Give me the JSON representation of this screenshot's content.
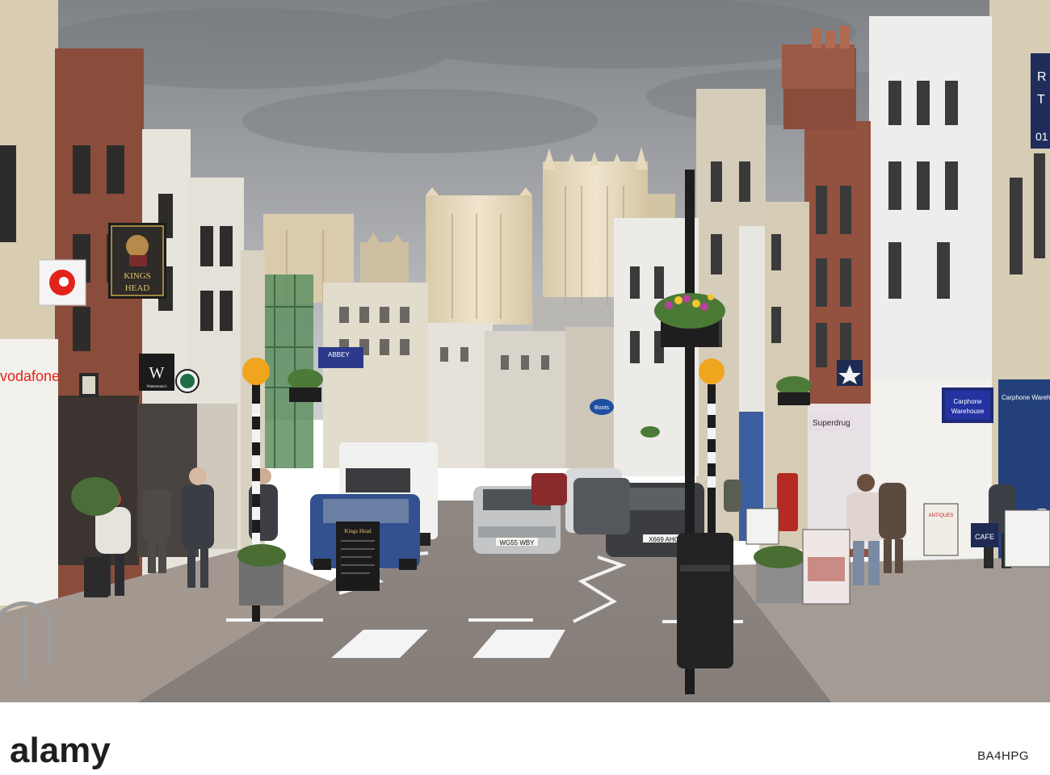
{
  "scene": {
    "description_tag": "street-scene",
    "palette": {
      "sky": "#8e9196",
      "sky_light": "#c3c5c7",
      "cathedral": "#e9dcc0",
      "road": "#8d8580",
      "pavement": "#a39b93",
      "brick": "#8a4b3a",
      "white_building": "#e9e8e4",
      "dark": "#1f1f1f"
    }
  },
  "signs": {
    "pub_name_line1": "KINGS",
    "pub_name_line2": "HEAD",
    "waterstones_letter": "W",
    "waterstones_name": "Waterstone's",
    "vodafone_fascia": "vodafone",
    "abbey_line1": "ABBEY",
    "boots": "Boots",
    "carphone_line1": "Carphone",
    "carphone_line2": "Warehouse",
    "carphone_fascia": "Carphone Warehouse",
    "superdrug": "Superdrug",
    "cafe": "CAFE",
    "antiques": "ANTIQUES",
    "top_right_sign_line1": "R",
    "top_right_sign_line2": "T",
    "top_right_sign_line3": "01",
    "board_title": "Kings Head"
  },
  "vehicles": {
    "silver_car_plate": "WG55 WBY",
    "dark_car_plate": "X669 AHO"
  },
  "footer": {
    "watermark": "alamy",
    "image_id": "BA4HPG"
  }
}
